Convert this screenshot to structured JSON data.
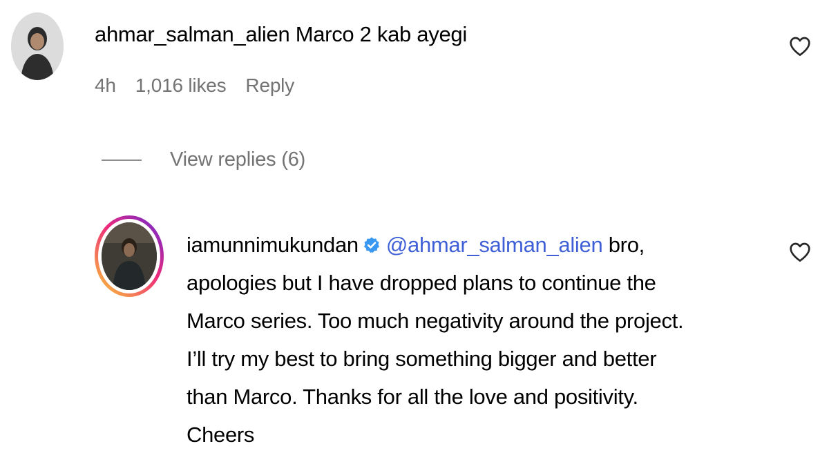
{
  "comments": [
    {
      "username": "ahmar_salman_alien",
      "text": "Marco 2 kab ayegi",
      "time": "4h",
      "likes": "1,016 likes",
      "reply_label": "Reply"
    }
  ],
  "view_replies": "View replies (6)",
  "reply": {
    "username": "iamunnimukundan",
    "mention": "@ahmar_salman_alien",
    "lines": [
      "bro,",
      "apologies but I have dropped plans to continue the",
      "Marco series. Too much negativity around the project.",
      "I’ll try my best to bring something bigger and better",
      "than Marco. Thanks for all the love and positivity.",
      "Cheers"
    ]
  },
  "icons": {
    "like": "heart-outline-icon",
    "verified": "verified-badge-icon"
  },
  "colors": {
    "mention": "#3e5fd6",
    "verified": "#3897f0",
    "meta": "#737373"
  }
}
